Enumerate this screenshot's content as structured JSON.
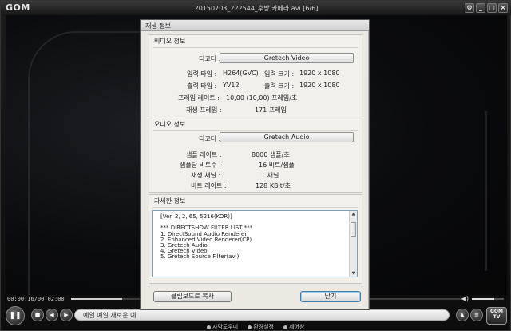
{
  "player": {
    "logo": "GOM",
    "title": "20150703_222544_후방 카메라.avi  [6/6]",
    "time": "00:00:16/00:02:00",
    "progress_fraction": 0.13,
    "volume_fraction": 0.7,
    "subtitle_text": "예일 예일 새로운 예",
    "gomtv_label": "GOM TV",
    "status_links": [
      "자막도우미",
      "환경설정",
      "제어창"
    ],
    "window_buttons": {
      "settings": "⚙",
      "minimize": "_",
      "maximize": "□",
      "close": "×"
    }
  },
  "dialog": {
    "title": "재생 정보",
    "video": {
      "heading": "비디오 정보",
      "decoder_label": "디코더 :",
      "decoder_value": "Gretech Video",
      "input_type_label": "입력 타입 :",
      "input_type_value": "H264(GVC)",
      "input_size_label": "입력 크기 :",
      "input_size_value": "1920 x 1080",
      "output_type_label": "출력 타입 :",
      "output_type_value": "YV12",
      "output_size_label": "출력 크기 :",
      "output_size_value": "1920 x 1080",
      "framerate_label": "프레임 레이트 :",
      "framerate_value": "10,00 (10,00) 프레임/초",
      "played_frames_label": "재생 프레임 :",
      "played_frames_value": "171 프레임"
    },
    "audio": {
      "heading": "오디오 정보",
      "decoder_label": "디코더 :",
      "decoder_value": "Gretech Audio",
      "sample_rate_label": "샘플 레이트 :",
      "sample_rate_value": "8000 샘플/초",
      "bits_label": "샘플당 비트수 :",
      "bits_value": "16 비트/샘플",
      "channels_label": "재생 채널 :",
      "channels_value": "1 채널",
      "bitrate_label": "비트 레이트 :",
      "bitrate_value": "128 KBit/초"
    },
    "details": {
      "heading": "자세한 정보",
      "text": "[Ver. 2, 2, 65, 5216(KOR)]\n\n*** DIRECTSHOW FILTER LIST ***\n1. DirectSound Audio Renderer\n2. Enhanced Video Renderer(CP)\n3. Gretech Audio\n4. Gretech Video\n5. Gretech Source Filter(avi)"
    },
    "copy_button": "클립보드로 복사",
    "close_button": "닫기"
  }
}
